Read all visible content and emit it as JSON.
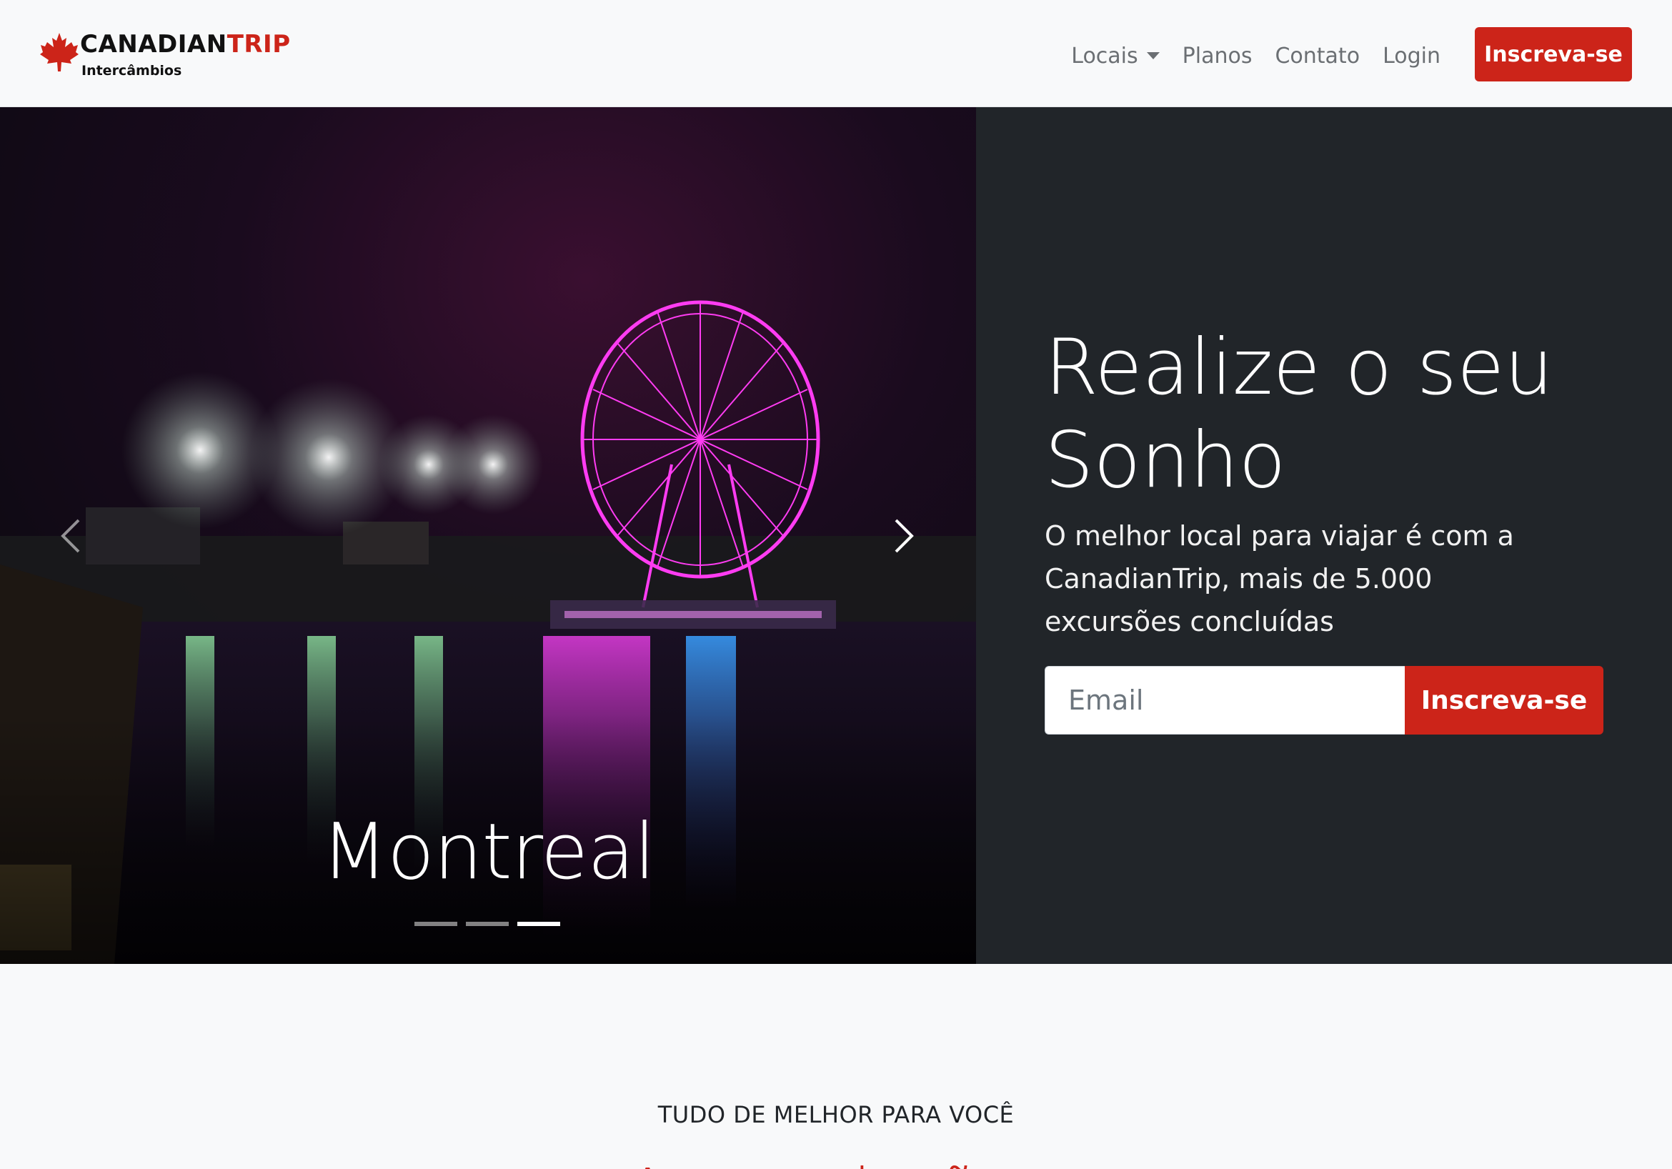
{
  "navbar": {
    "brand": {
      "name_main": "CANADIAN",
      "name_accent": "TRIP",
      "subtitle": "Intercâmbios",
      "logo_icon": "maple-leaf-icon"
    },
    "links": [
      {
        "label": "Locais",
        "has_dropdown": true
      },
      {
        "label": "Planos"
      },
      {
        "label": "Contato"
      },
      {
        "label": "Login"
      }
    ],
    "cta_label": "Inscreva-se"
  },
  "carousel": {
    "caption": "Montreal",
    "slide_count": 3,
    "active_slide": 3,
    "prev_icon": "chevron-left-icon",
    "next_icon": "chevron-right-icon"
  },
  "hero": {
    "headline": "Realize o seu Sonho",
    "lead": "O melhor local para viajar é com a CanadianTrip, mais de 5.000 excursões concluídas",
    "email_placeholder": "Email",
    "email_value": "",
    "submit_label": "Inscreva-se"
  },
  "section": {
    "eyebrow": "TUDO DE MELHOR PARA VOCÊ",
    "title": "Acomodações"
  },
  "colors": {
    "brand_red": "#cc2419",
    "dark_panel": "#212529",
    "navbar_bg": "#f8f9fa",
    "link_gray": "#6b6f73"
  }
}
